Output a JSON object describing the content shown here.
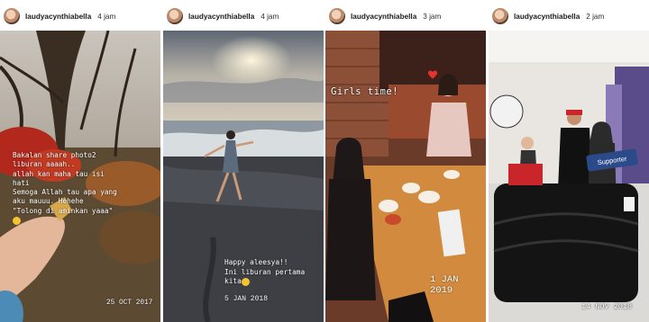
{
  "stories": [
    {
      "username": "laudyacynthiabella",
      "time": "4 jam",
      "caption_lines": [
        "Bakalan share photo2",
        "liburan aaaah..",
        "allah kan maha tau isi",
        "hati",
        "Semoga Allah tau apa yang",
        "aku mauuu. Hehehe",
        "\"Tolong di aminkan yaaa\""
      ],
      "date": "25 OCT 2017"
    },
    {
      "username": "laudyacynthiabella",
      "time": "4 jam",
      "caption_lines": [
        "Happy aleesya!!",
        "Ini liburan pertama",
        "kita"
      ],
      "date": "5 JAN 2018"
    },
    {
      "username": "laudyacynthiabella",
      "time": "3 jam",
      "caption": "Girls time!",
      "date": "1 JAN 2019"
    },
    {
      "username": "laudyacynthiabella",
      "time": "2 jam",
      "sticker": "Supporter",
      "date": "14 NOV 2018"
    }
  ],
  "icons": [
    "avatar",
    "progress-bar",
    "heart-sticker",
    "smile-emoji"
  ],
  "colors": {
    "heart": "#e8322f",
    "emoji": "#f4c430"
  }
}
